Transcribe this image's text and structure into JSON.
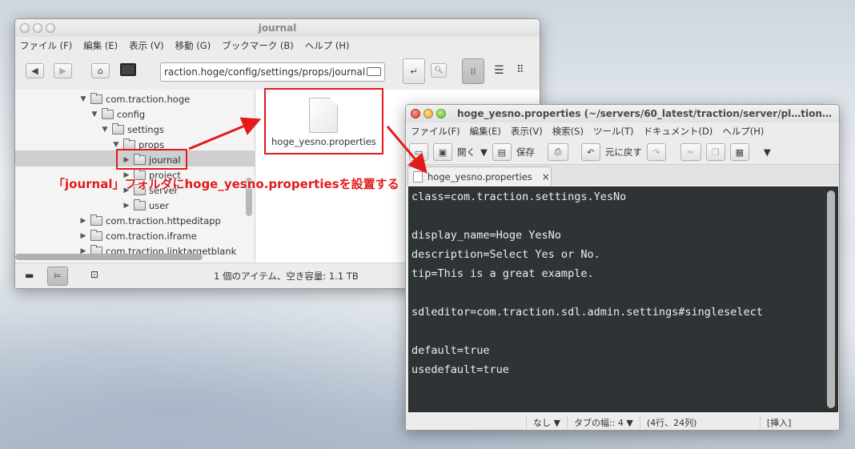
{
  "file_manager": {
    "title": "journal",
    "menu": [
      "ファイル (F)",
      "編集 (E)",
      "表示 (V)",
      "移動 (G)",
      "ブックマーク (B)",
      "ヘルプ (H)"
    ],
    "path": "raction.hoge/config/settings/props/journal",
    "tree": [
      {
        "label": "com.traction.hoge",
        "expander": "▼"
      },
      {
        "label": "config",
        "expander": "▼"
      },
      {
        "label": "settings",
        "expander": "▼"
      },
      {
        "label": "props",
        "expander": "▼"
      },
      {
        "label": "journal",
        "expander": "▶",
        "selected": true
      },
      {
        "label": "project",
        "expander": "▶"
      },
      {
        "label": "server",
        "expander": "▶"
      },
      {
        "label": "user",
        "expander": "▶"
      },
      {
        "label": "com.traction.httpeditapp",
        "expander": "▶"
      },
      {
        "label": "com.traction.iframe",
        "expander": "▶"
      },
      {
        "label": "com.traction.linktargetblank",
        "expander": "▶"
      }
    ],
    "file": {
      "name": "hoge_yesno.properties"
    },
    "status": "1 個のアイテム、空き容量: 1.1 TB"
  },
  "annotation": {
    "text": "「journal」フォルダにhoge_yesno.propertiesを設置する",
    "color": "#e21a1a"
  },
  "editor": {
    "title": "hoge_yesno.properties (~/servers/60_latest/traction/server/pl…tion…",
    "menu": [
      "ファイル(F)",
      "編集(E)",
      "表示(V)",
      "検索(S)",
      "ツール(T)",
      "ドキュメント(D)",
      "ヘルプ(H)"
    ],
    "toolbar": {
      "open": "開く",
      "save": "保存",
      "undo": "元に戻す"
    },
    "tab": {
      "label": "hoge_yesno.properties",
      "close": "×"
    },
    "lines": [
      "class=com.traction.settings.YesNo",
      "",
      "display_name=Hoge YesNo",
      "description=Select Yes or No.",
      "tip=This is a great example.",
      "",
      "sdleditor=com.traction.sdl.admin.settings#singleselect",
      "",
      "default=true",
      "usedefault=true"
    ],
    "status": {
      "highlight": "なし ▼",
      "tab_width": "タブの幅:: 4 ▼",
      "position": "(4行、24列)",
      "mode": "[挿入]"
    },
    "bg": "#2e3436"
  }
}
